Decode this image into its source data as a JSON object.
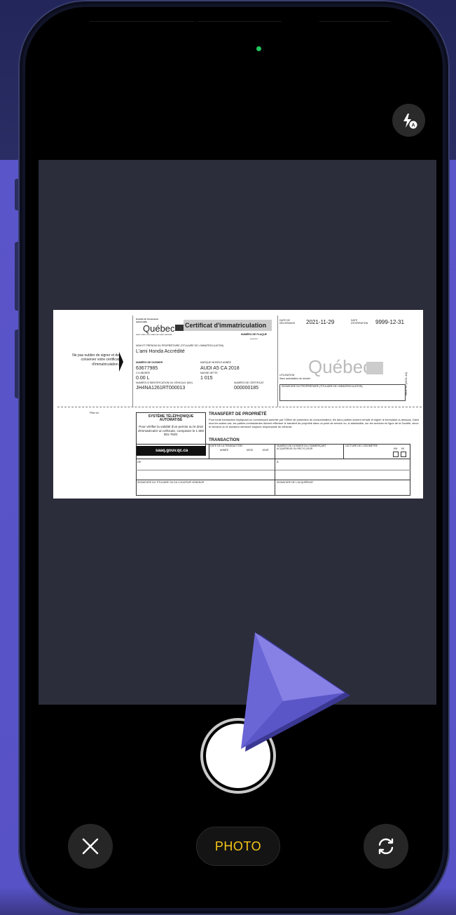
{
  "camera": {
    "mode_label": "PHOTO",
    "flash_icon": "flash-auto-icon",
    "close_icon": "close-icon",
    "switch_icon": "switch-camera-icon"
  },
  "document": {
    "insurer_line1": "Société de l'assurance",
    "insurer_line2": "automobile",
    "province": "Québec",
    "title": "Certificat d'immatriculation",
    "security_note": "Avec votre vos codes de votre sécurité",
    "plate_label": "NUMÉRO DE PLAQUE",
    "plate_value": "*******",
    "issue_label": "DATE DE DÉLIVRANCE",
    "issue_date": "2021-11-29",
    "expiry_label": "DATE D'EXPIRATION",
    "expiry_date": "9999-12-31",
    "owner_label": "NOM ET PRÉNOM DU PROPRIÉTAIRE (TITULAIRE DE L'IMMATRICULATION)",
    "owner_name": "L'ami Honda Accrédité",
    "reminder_text": "Ne pas oublier de signer et de conserver votre certificat d'immatriculation.",
    "file_label": "NUMÉRO DE DOSSIER",
    "file_value": "63677985",
    "make_label": "MARQUE MODÈLE ANNÉE",
    "make_value": "AUDI A5 CA 2018",
    "cyl_label": "CYLINDRÉE",
    "cyl_value": "0.00 L",
    "mass_label": "MASSE NETTE",
    "mass_value": "1 015",
    "vin_label": "NUMÉRO D'IDENTIFICATION DU VÉHICULE (NIV)",
    "vin_value": "JH4NA1261RT000013",
    "cert_label": "NUMÉRO DE CERTIFICAT",
    "cert_value": "000000185",
    "usage_label": "UTILISATION",
    "usage_value": "Sans autorisation de circuler",
    "owner_sig_label": "SIGNATURE DU PROPRIÉTAIRE (TITULAIRE DE L'IMMATRICULATION)",
    "fold_text": "Plier ici",
    "phone_box_title": "SYSTÈME TÉLÉPHONIQUE AUTOMATISÉ",
    "phone_box_text": "Pour vérifier la validité d'un permis ou le droit d'immatriculer un véhicule, composez le 1 800 361-7620.",
    "website": "saaq.gouv.qc.ca",
    "transfer_title": "TRANSFERT DE PROPRIÉTÉ",
    "transfer_text": "Pour toute transaction impliquant un commerçant autorisé par l'Office de protection du consommateur, les deux parties doivent remplir et signer le formulaire ci-dessous. Dans tous les autres cas, les parties contractantes doivent effectuer le transfert de propriété dans un point de service ou, si admissible, sur les services en ligne de la Société, sinon le vendeur ou le donateur demeure toujours responsable du véhicule.",
    "transaction_label": "TRANSACTION",
    "transaction_date_label": "DATE DE LA TRANSACTION",
    "year_label": "ANNÉE",
    "month_label": "MOIS",
    "day_label": "JOUR",
    "dealer_label": "NUMÉRO DE DOSSIER DU COMMERÇANT ACQUÉREUR OU RECYCLEUR",
    "odometer_label": "LECTURE DE L'ODOMÈTRE",
    "km_label": "KM",
    "mi_label": "MI",
    "from_label": "DE",
    "to_label": "À",
    "seller_sig_label": "SIGNATURE DU TITULAIRE OU DU LOCATEUR VENDEUR",
    "buyer_sig_label": "SIGNATURE DE L'ACQUÉREUR",
    "form_code": "6805 95 (2021-10)"
  }
}
